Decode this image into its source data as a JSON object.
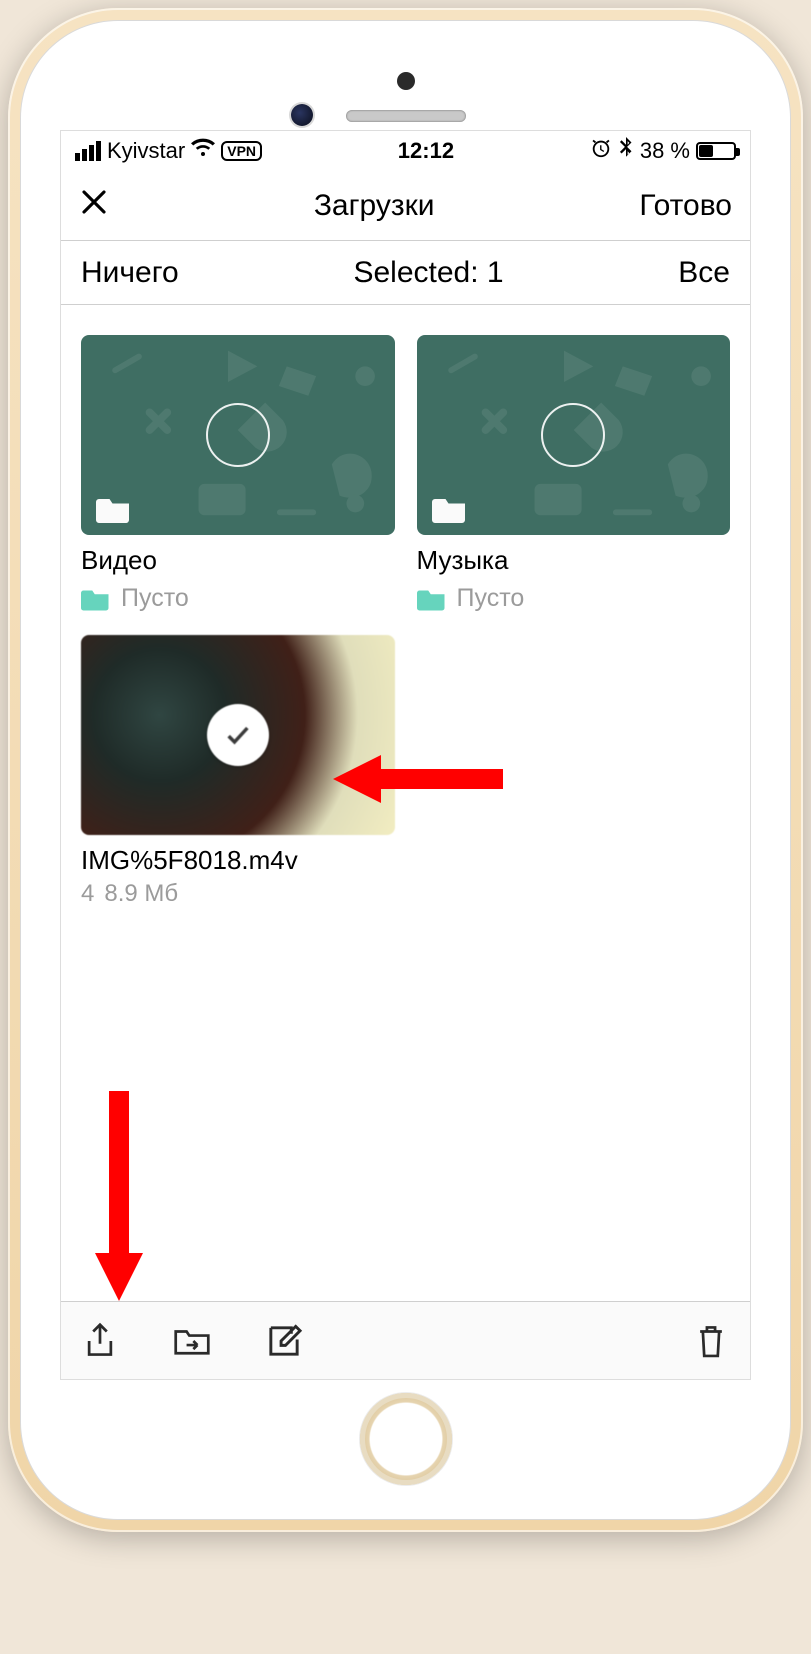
{
  "status_bar": {
    "carrier": "Kyivstar",
    "vpn_label": "VPN",
    "time": "12:12",
    "battery_percent": "38 %"
  },
  "nav": {
    "title": "Загрузки",
    "done_label": "Готово"
  },
  "selection_bar": {
    "none_label": "Ничего",
    "selected_label": "Selected: 1",
    "all_label": "Все"
  },
  "folders": [
    {
      "name": "Видео",
      "status": "Пусто"
    },
    {
      "name": "Музыка",
      "status": "Пусто"
    }
  ],
  "file": {
    "name": "IMG%5F8018.m4v",
    "count": "4",
    "size": "8.9 Мб"
  }
}
